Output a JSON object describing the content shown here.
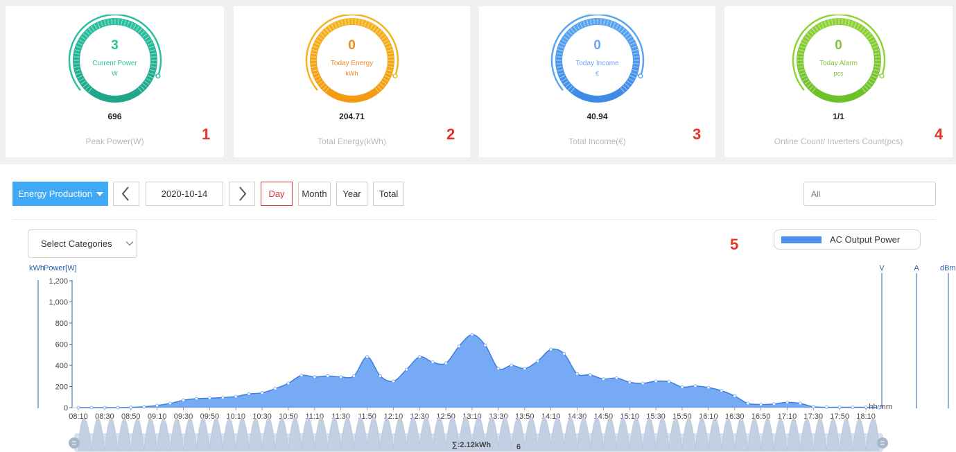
{
  "cards": [
    {
      "gauge_value": "3",
      "gauge_label": "Current Power",
      "gauge_unit": "W",
      "total_value": "696",
      "total_label": "Peak Power(W)",
      "marker": "1",
      "color": "#2bbfa0",
      "color2": "#1fa58a",
      "text_color": "#2bbfa0",
      "gauge_level": 0.004
    },
    {
      "gauge_value": "0",
      "gauge_label": "Today Energy",
      "gauge_unit": "kWh",
      "total_value": "204.71",
      "total_label": "Total Energy(kWh)",
      "marker": "2",
      "color": "#f5b21f",
      "color2": "#f39a11",
      "text_color": "#f08a24",
      "gauge_level": 0.0
    },
    {
      "gauge_value": "0",
      "gauge_label": "Today Income",
      "gauge_unit": "€",
      "total_value": "40.94",
      "total_label": "Total Income(€)",
      "marker": "3",
      "color": "#5aa5f0",
      "color2": "#3d8ae8",
      "text_color": "#6aa8f0",
      "gauge_level": 0.0
    },
    {
      "gauge_value": "0",
      "gauge_label": "Today Alarm",
      "gauge_unit": "pcs",
      "total_value": "1/1",
      "total_label": "Online Count/ Inverters Count(pcs)",
      "marker": "4",
      "color": "#8fd23a",
      "color2": "#6cc02a",
      "text_color": "#7cc63a",
      "gauge_level": 0.0
    }
  ],
  "toolbar": {
    "dropdown_label": "Energy Production",
    "date": "2020-10-14",
    "periods": [
      "Day",
      "Month",
      "Year",
      "Total"
    ],
    "active_period": "Day",
    "filter_placeholder": "All",
    "accent": "#3fa9f5"
  },
  "categories_select": "Select Categories",
  "marker_legend": "5",
  "marker_sum": "6",
  "legend_label": "AC Output Power",
  "summary": "∑:2.12kWh",
  "chart_data": {
    "type": "area",
    "series": [
      {
        "name": "AC Output Power",
        "color": "#4a8ef0"
      }
    ],
    "left_axis_units": [
      "kWh",
      "Power[W]"
    ],
    "right_axis_units": [
      "V",
      "A",
      "dBm"
    ],
    "x_unit": "hh:mm",
    "ylim": [
      0,
      1200
    ],
    "y_ticks": [
      "0",
      "200",
      "400",
      "600",
      "800",
      "1,000",
      "1,200"
    ],
    "x_tick_labels": [
      "08:10",
      "08:30",
      "08:50",
      "09:10",
      "09:30",
      "09:50",
      "10:10",
      "10:30",
      "10:50",
      "11:10",
      "11:30",
      "11:50",
      "12:10",
      "12:30",
      "12:50",
      "13:10",
      "13:30",
      "13:50",
      "14:10",
      "14:30",
      "14:50",
      "15:10",
      "15:30",
      "15:50",
      "16:10",
      "16:30",
      "16:50",
      "17:10",
      "17:30",
      "17:50",
      "18:10"
    ],
    "x": [
      "08:10",
      "08:20",
      "08:30",
      "08:40",
      "08:50",
      "09:00",
      "09:10",
      "09:20",
      "09:30",
      "09:40",
      "09:50",
      "10:00",
      "10:10",
      "10:20",
      "10:30",
      "10:40",
      "10:50",
      "11:00",
      "11:10",
      "11:20",
      "11:30",
      "11:40",
      "11:50",
      "12:00",
      "12:10",
      "12:20",
      "12:30",
      "12:40",
      "12:50",
      "13:00",
      "13:10",
      "13:20",
      "13:30",
      "13:40",
      "13:50",
      "14:00",
      "14:10",
      "14:20",
      "14:30",
      "14:40",
      "14:50",
      "15:00",
      "15:10",
      "15:20",
      "15:30",
      "15:40",
      "15:50",
      "16:00",
      "16:10",
      "16:20",
      "16:30",
      "16:40",
      "16:50",
      "17:00",
      "17:10",
      "17:20",
      "17:30",
      "17:40",
      "17:50",
      "18:00",
      "18:10",
      "18:20"
    ],
    "values": [
      0,
      0,
      0,
      0,
      2,
      8,
      20,
      40,
      70,
      85,
      90,
      95,
      105,
      130,
      140,
      180,
      230,
      305,
      290,
      300,
      290,
      300,
      480,
      300,
      250,
      360,
      480,
      430,
      420,
      580,
      690,
      590,
      370,
      400,
      370,
      440,
      550,
      510,
      320,
      310,
      270,
      280,
      240,
      230,
      250,
      245,
      195,
      205,
      190,
      160,
      110,
      40,
      30,
      35,
      50,
      40,
      8,
      3,
      3,
      3,
      3,
      0
    ],
    "grid": false,
    "legend_position": "top-right"
  }
}
